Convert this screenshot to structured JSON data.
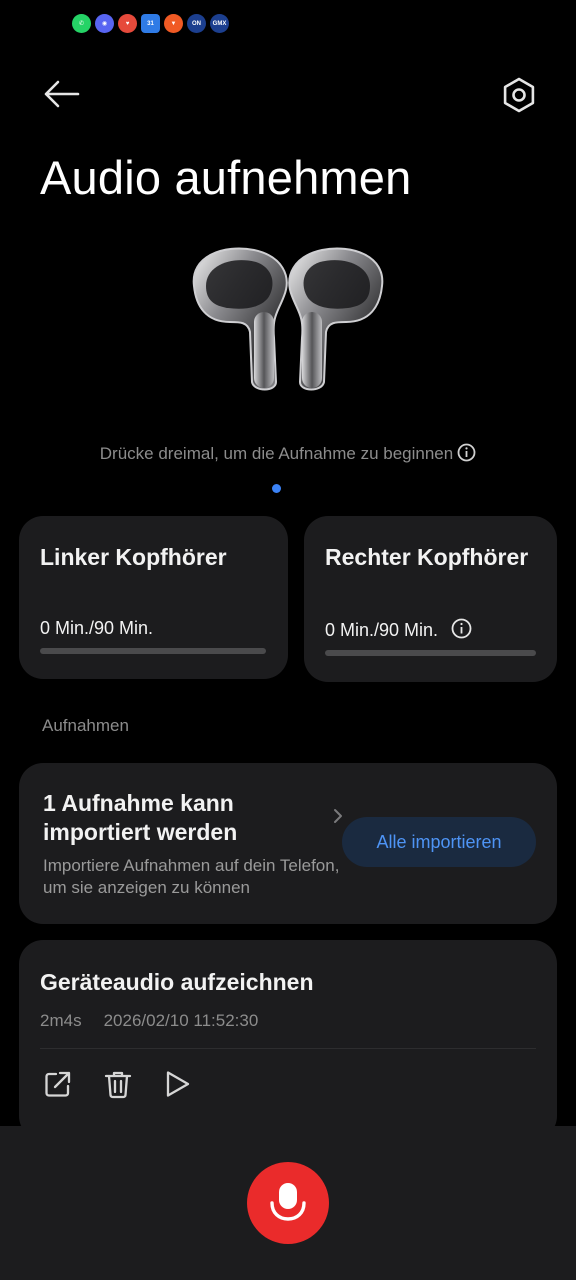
{
  "status_icons": [
    {
      "name": "whatsapp-icon",
      "color": "#25d366",
      "glyph": "✆"
    },
    {
      "name": "discord-icon",
      "color": "#5865f2",
      "glyph": "◉"
    },
    {
      "name": "app-red-icon",
      "color": "#e64a3b",
      "glyph": "♥"
    },
    {
      "name": "calendar-icon",
      "color": "#2f7be6",
      "glyph": "31"
    },
    {
      "name": "brave-icon",
      "color": "#f05a24",
      "glyph": "▼"
    },
    {
      "name": "onlyoffice-icon",
      "color": "#1c3f8f",
      "glyph": "ON"
    },
    {
      "name": "gmx-icon",
      "color": "#1c3f8f",
      "glyph": "GMX"
    }
  ],
  "header": {
    "back_icon": "arrow-left-icon",
    "settings_icon": "gear-icon",
    "title": "Audio aufnehmen"
  },
  "hint": {
    "text": "Drücke dreimal, um die Aufnahme zu beginnen",
    "icon": "info-icon"
  },
  "earbuds": {
    "left": {
      "name": "Linker Kopfhörer",
      "usage": "0 Min./90 Min.",
      "used_fraction": 0
    },
    "right": {
      "name": "Rechter Kopfhörer",
      "usage": "0 Min./90 Min.",
      "used_fraction": 0
    }
  },
  "recordings_section": {
    "label": "Aufnahmen"
  },
  "import_card": {
    "headline": "1 Aufnahme kann importiert werden",
    "description": "Importiere Aufnahmen auf dein Telefon, um sie anzeigen zu können",
    "button_label": "Alle importieren"
  },
  "recording": {
    "title": "Geräteaudio aufzeichnen",
    "duration": "2m4s",
    "timestamp": "2026/02/10 11:52:30",
    "actions": [
      "share-icon",
      "trash-icon",
      "play-icon"
    ]
  },
  "record_button": {
    "icon": "microphone-icon",
    "color": "#ea2b2b"
  }
}
